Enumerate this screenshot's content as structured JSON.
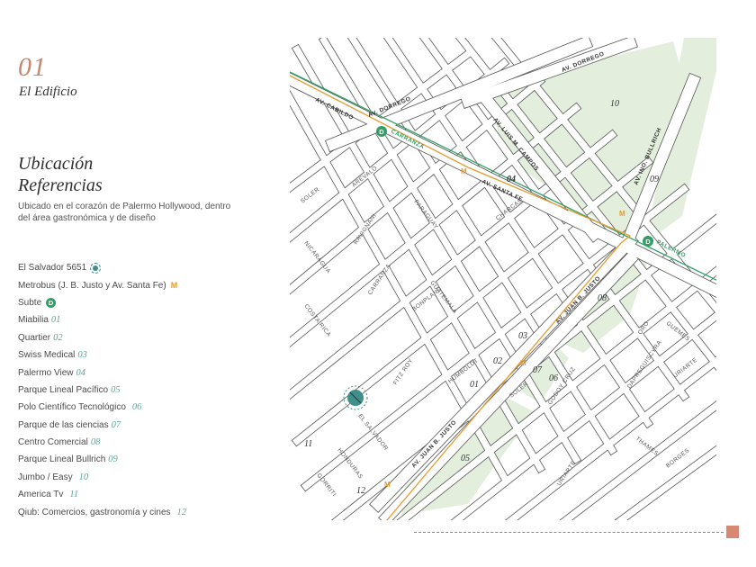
{
  "header": {
    "section_number": "01",
    "section_title": "El Edificio"
  },
  "intro": {
    "heading_line1": "Ubicación",
    "heading_line2": "Referencias",
    "description": "Ubicado en el corazón de Palermo Hollywood, dentro del área gastronómica y de diseño"
  },
  "legend": {
    "items": [
      {
        "label": "El Salvador 5651",
        "marker": "target-icon"
      },
      {
        "label": "Metrobus (J. B. Justo y Av. Santa Fe)",
        "marker": "metrobus-icon",
        "marker_text": "M"
      },
      {
        "label": "Subte",
        "marker": "subte-icon",
        "marker_text": "D"
      },
      {
        "label": "Miabilia",
        "num": "01"
      },
      {
        "label": "Quartier",
        "num": "02"
      },
      {
        "label": "Swiss Medical",
        "num": "03"
      },
      {
        "label": "Palermo View",
        "num": "04"
      },
      {
        "label": "Parque Lineal Pacífico",
        "num": "05"
      },
      {
        "label": "Polo Científico Tecnológico",
        "num": "06"
      },
      {
        "label": "Parque de las ciencias",
        "num": "07"
      },
      {
        "label": "Centro Comercial",
        "num": "08"
      },
      {
        "label": "Parque Lineal Bullrich",
        "num": "09"
      },
      {
        "label": "Jumbo / Easy",
        "num": "10"
      },
      {
        "label": "America Tv",
        "num": "11"
      },
      {
        "label": "Qiub: Comercios, gastronomía y cines",
        "num": "12"
      }
    ]
  },
  "map": {
    "colors": {
      "street": "#555555",
      "park": "#e3efdc",
      "subte_line": "#2f9f66",
      "metrobus_line": "#e69a2e",
      "target": "#3f8f8a"
    },
    "avenues": [
      {
        "id": "av-cabildo",
        "label": "AV. CABILDO"
      },
      {
        "id": "av-dorrego-1",
        "label": "AV. DORREGO"
      },
      {
        "id": "av-dorrego-2",
        "label": "AV. DORREGO"
      },
      {
        "id": "av-luis-campos",
        "label": "AV. LUIS M. CAMPOS"
      },
      {
        "id": "av-bullrich",
        "label": "AV. INO. BULLRICH"
      },
      {
        "id": "av-santa-fe",
        "label": "AV. SANTA FE"
      },
      {
        "id": "av-juan-b-justo-1",
        "label": "AV. JUAN B. JUSTO"
      },
      {
        "id": "av-juan-b-justo-2",
        "label": "AV. JUAN B. JUSTO"
      }
    ],
    "streets": [
      {
        "id": "st-soler-1",
        "label": "SOLER"
      },
      {
        "id": "st-arevalo",
        "label": "AREVALO"
      },
      {
        "id": "st-paraguay",
        "label": "PARAGUAY"
      },
      {
        "id": "st-charcas",
        "label": "CHARCAS"
      },
      {
        "id": "st-ravignani",
        "label": "RAVIGNANI"
      },
      {
        "id": "st-nicaragua",
        "label": "NICARAGUA"
      },
      {
        "id": "st-carranza",
        "label": "CARRANZA"
      },
      {
        "id": "st-bonpland",
        "label": "BONPLAND"
      },
      {
        "id": "st-guatemala",
        "label": "GUATEMALA"
      },
      {
        "id": "st-costa-rica",
        "label": "COSTA RICA"
      },
      {
        "id": "st-fitz-roy",
        "label": "FITZ ROY"
      },
      {
        "id": "st-humboldt",
        "label": "HUMBOLDT"
      },
      {
        "id": "st-el-salvador",
        "label": "EL SALVADOR"
      },
      {
        "id": "st-honduras",
        "label": "HONDURAS"
      },
      {
        "id": "st-gorriti",
        "label": "GORRITI"
      },
      {
        "id": "st-soler-2",
        "label": "SOLER"
      },
      {
        "id": "st-godoy-cruz",
        "label": "GODOY CRUZ"
      },
      {
        "id": "st-oro",
        "label": "ORO"
      },
      {
        "id": "st-guemes",
        "label": "GUEMES"
      },
      {
        "id": "st-uriarte-1",
        "label": "URIARTE"
      },
      {
        "id": "st-dapreguiscyra",
        "label": "DAPREGUISCYRA"
      },
      {
        "id": "st-thames",
        "label": "THAMES"
      },
      {
        "id": "st-uriarte-2",
        "label": "URIARTE"
      },
      {
        "id": "st-borges",
        "label": "BORGES"
      }
    ],
    "stations": [
      {
        "id": "station-carranza",
        "label": "CARRANZA",
        "badge": "D"
      },
      {
        "id": "station-palermo",
        "label": "PALERMO",
        "badge": "D"
      }
    ],
    "metrobus_marker": "M",
    "references": [
      {
        "id": "ref-01",
        "num": "01"
      },
      {
        "id": "ref-02",
        "num": "02"
      },
      {
        "id": "ref-03",
        "num": "03"
      },
      {
        "id": "ref-04",
        "num": "04"
      },
      {
        "id": "ref-05",
        "num": "05"
      },
      {
        "id": "ref-06",
        "num": "06"
      },
      {
        "id": "ref-07",
        "num": "07"
      },
      {
        "id": "ref-08",
        "num": "08"
      },
      {
        "id": "ref-09",
        "num": "09"
      },
      {
        "id": "ref-10",
        "num": "10"
      },
      {
        "id": "ref-11",
        "num": "11"
      },
      {
        "id": "ref-12",
        "num": "12"
      }
    ]
  }
}
